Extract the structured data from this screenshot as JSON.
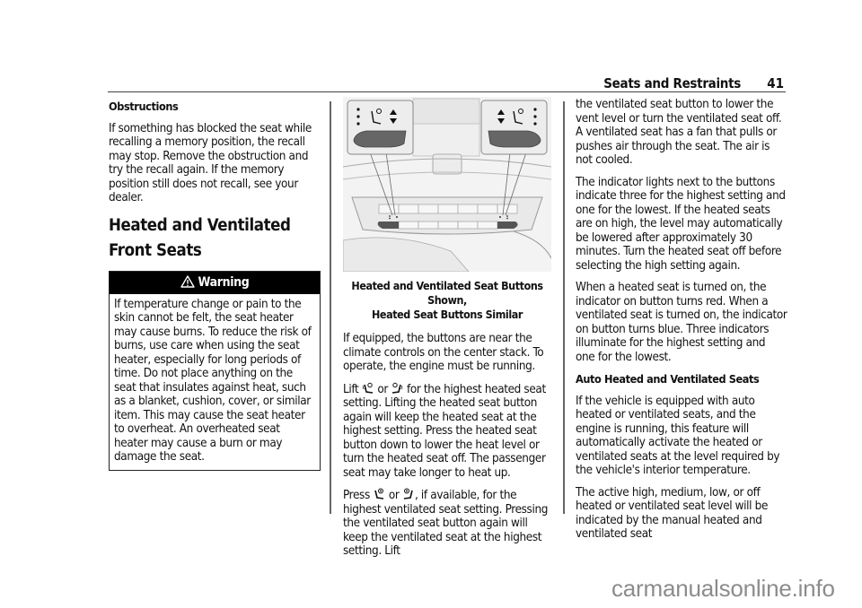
{
  "header": {
    "title": "Seats and Restraints",
    "page_number": "41"
  },
  "column1": {
    "subheading": "Obstructions",
    "paragraph1": "If something has blocked the seat while recalling a memory position, the recall may stop. Remove the obstruction and try the recall again. If the memory position still does not recall, see your dealer.",
    "section_title": "Heated and Ventilated Front Seats",
    "warning": {
      "icon": "warning-triangle-icon",
      "label": "Warning",
      "text": "If temperature change or pain to the skin cannot be felt, the seat heater may cause burns. To reduce the risk of burns, use care when using the seat heater, especially for long periods of time. Do not place anything on the seat that insulates against heat, such as a blanket, cushion, cover, or similar item. This may cause the seat heater to overheat. An overheated seat heater may cause a burn or may damage the seat."
    }
  },
  "column2": {
    "figure": {
      "description": "Center stack climate control panel with callouts to driver and passenger heated/ventilated seat buttons",
      "icons": [
        "heated-seat-icon",
        "ventilated-seat-icon",
        "up-down-arrow-icon",
        "indicator-dots-icon"
      ]
    },
    "caption_line1": "Heated and Ventilated Seat Buttons Shown,",
    "caption_line2": "Heated Seat Buttons Similar",
    "paragraph1": "If equipped, the buttons are near the climate controls on the center stack. To operate, the engine must be running.",
    "p2_lift": "Lift",
    "p2_or": "or",
    "p2_rest": "for the highest heated seat setting. Lifting the heated seat button again will keep the heated seat at the highest setting. Press the heated seat button down to lower the heat level or turn the heated seat off. The passenger seat may take longer to heat up.",
    "p3_press": "Press",
    "p3_or": "or",
    "p3_rest": ", if available, for the highest ventilated seat setting. Pressing the ventilated seat button again will keep the ventilated seat at the highest setting. Lift"
  },
  "column3": {
    "paragraph1": "the ventilated seat button to lower the vent level or turn the ventilated seat off.",
    "paragraph1b": "A ventilated seat has a fan that pulls or pushes air through the seat. The air is not cooled.",
    "paragraph2": "The indicator lights next to the buttons indicate three for the highest setting and one for the lowest. If the heated seats are on high, the level may automatically be lowered after approximately 30 minutes. Turn the heated seat off before selecting the high setting again.",
    "paragraph3": "When a heated seat is turned on, the indicator on button turns red. When a ventilated seat is turned on, the indicator on button turns blue. Three indicators illuminate for the highest setting and one for the lowest.",
    "subheading": "Auto Heated and Ventilated Seats",
    "paragraph4": "If the vehicle is equipped with auto heated or ventilated seats, and the engine is running, this feature will automatically activate the heated or ventilated seats at the level required by the vehicle's interior temperature.",
    "paragraph5": "The active high, medium, low, or off heated or ventilated seat level will be indicated by the manual heated and ventilated seat"
  },
  "watermark": "carmanualsonline.info"
}
